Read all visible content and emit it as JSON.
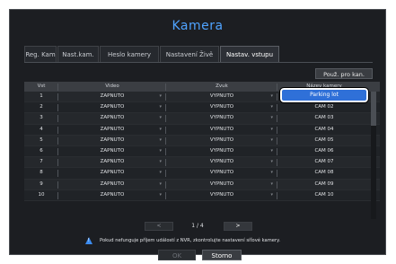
{
  "dialog": {
    "title": "Kamera"
  },
  "tabs": [
    {
      "label": "Reg. Kam"
    },
    {
      "label": "Nast.kam."
    },
    {
      "label": "Heslo kamery"
    },
    {
      "label": "Nastavení Živě"
    },
    {
      "label": "Nastav. vstupu",
      "active": true
    }
  ],
  "toolbar": {
    "apply_all_label": "Použ. pro kan."
  },
  "table": {
    "headers": [
      "Vst",
      "Video",
      "Zvuk",
      "Název kamery"
    ],
    "rows": [
      {
        "ch": "1",
        "video": "ZAPNUTO",
        "audio": "VYPNUTO",
        "name": "Parking lot"
      },
      {
        "ch": "2",
        "video": "ZAPNUTO",
        "audio": "VYPNUTO",
        "name": "CAM 02"
      },
      {
        "ch": "3",
        "video": "ZAPNUTO",
        "audio": "VYPNUTO",
        "name": "CAM 03"
      },
      {
        "ch": "4",
        "video": "ZAPNUTO",
        "audio": "VYPNUTO",
        "name": "CAM 04"
      },
      {
        "ch": "5",
        "video": "ZAPNUTO",
        "audio": "VYPNUTO",
        "name": "CAM 05"
      },
      {
        "ch": "6",
        "video": "ZAPNUTO",
        "audio": "VYPNUTO",
        "name": "CAM 06"
      },
      {
        "ch": "7",
        "video": "ZAPNUTO",
        "audio": "VYPNUTO",
        "name": "CAM 07"
      },
      {
        "ch": "8",
        "video": "ZAPNUTO",
        "audio": "VYPNUTO",
        "name": "CAM 08"
      },
      {
        "ch": "9",
        "video": "ZAPNUTO",
        "audio": "VYPNUTO",
        "name": "CAM 09"
      },
      {
        "ch": "10",
        "video": "ZAPNUTO",
        "audio": "VYPNUTO",
        "name": "CAM 10"
      }
    ]
  },
  "pager": {
    "info": "1 / 4",
    "prev": "<",
    "next": ">"
  },
  "notice": {
    "text": "Pokud nefunguje příjem událostí z NVR, zkontrolujte nastavení síťové kamery."
  },
  "buttons": {
    "ok": "OK",
    "cancel": "Storno"
  },
  "colors": {
    "accent": "#4fa3ff",
    "selection": "#2f70d8",
    "background": "#1c1e22"
  }
}
